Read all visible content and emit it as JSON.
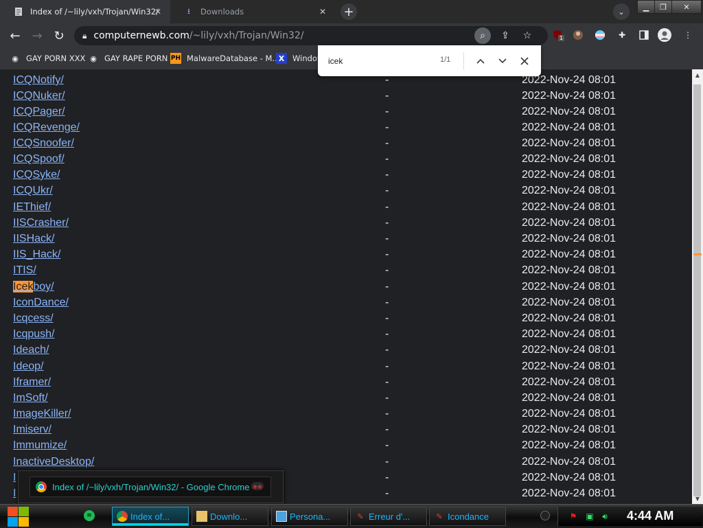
{
  "tabs": [
    {
      "title": "Index of /~lily/vxh/Trojan/Win32/",
      "icon": "web-page-icon",
      "active": true
    },
    {
      "title": "Downloads",
      "icon": "download-icon",
      "active": false
    }
  ],
  "toolbar": {
    "url_host": "computernewb.com",
    "url_path": "/~lily/vxh/Trojan/Win32/",
    "extension_badge": "1"
  },
  "bookmarks": [
    {
      "label": "GAY PORN XXX",
      "icon": "globe-icon"
    },
    {
      "label": "GAY RAPE PORN",
      "icon": "globe-icon"
    },
    {
      "label": "MalwareDatabase - M...",
      "icon": "ph-icon"
    },
    {
      "label": "Window",
      "icon": "x-icon"
    }
  ],
  "find": {
    "query": "icek",
    "count": "1/1"
  },
  "listing": [
    {
      "name": "ICQNotify/",
      "size": "-",
      "date": "2022-Nov-24 08:01"
    },
    {
      "name": "ICQNuker/",
      "size": "-",
      "date": "2022-Nov-24 08:01"
    },
    {
      "name": "ICQPager/",
      "size": "-",
      "date": "2022-Nov-24 08:01"
    },
    {
      "name": "ICQRevenge/",
      "size": "-",
      "date": "2022-Nov-24 08:01"
    },
    {
      "name": "ICQSnoofer/",
      "size": "-",
      "date": "2022-Nov-24 08:01"
    },
    {
      "name": "ICQSpoof/",
      "size": "-",
      "date": "2022-Nov-24 08:01"
    },
    {
      "name": "ICQSyke/",
      "size": "-",
      "date": "2022-Nov-24 08:01"
    },
    {
      "name": "ICQUkr/",
      "size": "-",
      "date": "2022-Nov-24 08:01"
    },
    {
      "name": "IEThief/",
      "size": "-",
      "date": "2022-Nov-24 08:01"
    },
    {
      "name": "IISCrasher/",
      "size": "-",
      "date": "2022-Nov-24 08:01"
    },
    {
      "name": "IISHack/",
      "size": "-",
      "date": "2022-Nov-24 08:01"
    },
    {
      "name": "IIS_Hack/",
      "size": "-",
      "date": "2022-Nov-24 08:01"
    },
    {
      "name": "ITIS/",
      "size": "-",
      "date": "2022-Nov-24 08:01"
    },
    {
      "name": "Icekboy/",
      "size": "-",
      "date": "2022-Nov-24 08:01",
      "match": "Icek",
      "rest": "boy/"
    },
    {
      "name": "IconDance/",
      "size": "-",
      "date": "2022-Nov-24 08:01"
    },
    {
      "name": "Icqcess/",
      "size": "-",
      "date": "2022-Nov-24 08:01"
    },
    {
      "name": "Icqpush/",
      "size": "-",
      "date": "2022-Nov-24 08:01"
    },
    {
      "name": "Ideach/",
      "size": "-",
      "date": "2022-Nov-24 08:01"
    },
    {
      "name": "Ideop/",
      "size": "-",
      "date": "2022-Nov-24 08:01"
    },
    {
      "name": "Iframer/",
      "size": "-",
      "date": "2022-Nov-24 08:01"
    },
    {
      "name": "ImSoft/",
      "size": "-",
      "date": "2022-Nov-24 08:01"
    },
    {
      "name": "ImageKiller/",
      "size": "-",
      "date": "2022-Nov-24 08:01"
    },
    {
      "name": "Imiserv/",
      "size": "-",
      "date": "2022-Nov-24 08:01"
    },
    {
      "name": "Immumize/",
      "size": "-",
      "date": "2022-Nov-24 08:01"
    },
    {
      "name": "InactiveDesktop/",
      "size": "-",
      "date": "2022-Nov-24 08:01"
    },
    {
      "name": "I",
      "size": "-",
      "date": "2022-Nov-24 08:01"
    },
    {
      "name": "I",
      "size": "-",
      "date": "2022-Nov-24 08:01"
    }
  ],
  "tooltip": {
    "text": "Index of /~lily/vxh/Trojan/Win32/ - Google Chrome"
  },
  "taskbar": {
    "buttons": [
      {
        "label": "Index of...",
        "icon": "chrome-icon",
        "active": true
      },
      {
        "label": "Downlo...",
        "icon": "folder-icon",
        "active": false
      },
      {
        "label": "Persona...",
        "icon": "display-settings-icon",
        "active": false
      },
      {
        "label": "Erreur d'...",
        "icon": "app-icon",
        "active": false
      },
      {
        "label": "Icondance",
        "icon": "app-icon",
        "active": false
      }
    ],
    "clock": "4:44 AM"
  },
  "colors": {
    "link": "#8ab4f8",
    "find_highlight": "#ff9632",
    "taskbar_accent": "#00d2e6"
  }
}
